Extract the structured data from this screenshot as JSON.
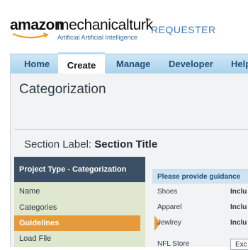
{
  "header": {
    "logo_amazon": "amazon",
    "logo_product": "mechanicalturk",
    "logo_tm": "™",
    "tagline": "Artificial Artificial Intelligence",
    "role": "REQUESTER"
  },
  "nav": {
    "tabs": [
      {
        "label": "Home"
      },
      {
        "label": "Create"
      },
      {
        "label": "Manage"
      },
      {
        "label": "Developer"
      },
      {
        "label": "Help"
      }
    ],
    "active": "Create"
  },
  "page": {
    "title": "Categorization",
    "section_label_prefix": "Section Label:",
    "section_label_value": "Section Title"
  },
  "steps": {
    "header": "Project Type - Categorization",
    "items": [
      {
        "label": "Name"
      },
      {
        "label": "Categories"
      },
      {
        "label": "Guidelines"
      },
      {
        "label": "Load File"
      }
    ],
    "active": "Guidelines"
  },
  "table": {
    "heading": "Please provide guidance",
    "rows": [
      {
        "category": "Shoes",
        "guidance": "Inclu"
      },
      {
        "category": "Apparel",
        "guidance": "Inclu"
      },
      {
        "category": "Jewlrey",
        "guidance": "Inclu"
      },
      {
        "category": "NFL Store",
        "guidance": "Exc"
      }
    ]
  },
  "colors": {
    "nav_bg": "#a9d1ec",
    "step_active": "#e89a3a",
    "steps_header": "#3b5064",
    "steps_bg": "#dfe7cf",
    "accent_blue": "#3a79b8"
  }
}
